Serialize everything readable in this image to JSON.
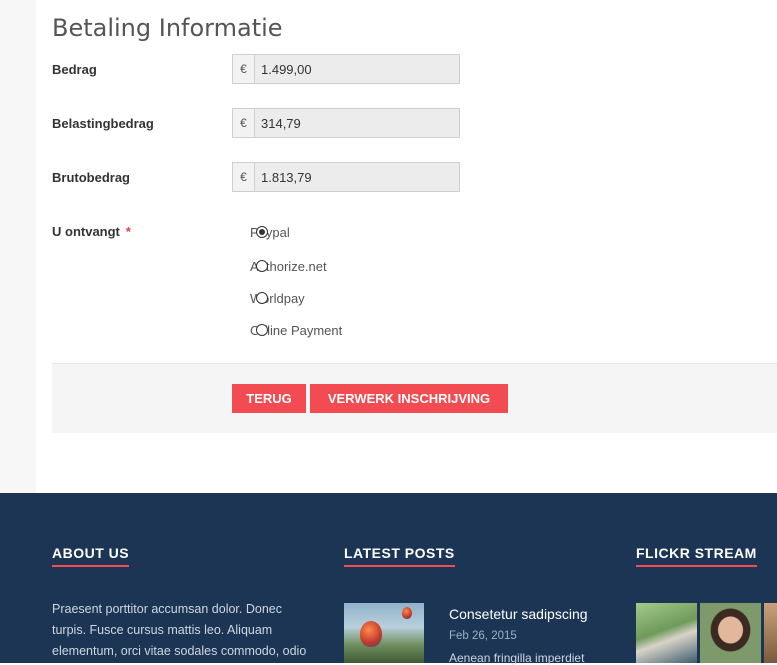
{
  "payment": {
    "title": "Betaling Informatie",
    "currency_symbol": "€",
    "fields": [
      {
        "label": "Bedrag",
        "value": "1.499,00"
      },
      {
        "label": "Belastingbedrag",
        "value": "314,79"
      },
      {
        "label": "Brutobedrag",
        "value": "1.813,79"
      }
    ],
    "method_label": "U ontvangt",
    "required_mark": "*",
    "methods": [
      "Paypal",
      "Authorize.net",
      "Worldpay",
      "Offline Payment"
    ],
    "selected_method": "Paypal",
    "back_label": "TERUG",
    "submit_label": "VERWERK INSCHRIJVING"
  },
  "footer": {
    "about_title": "ABOUT US",
    "about_text": "Praesent porttitor accumsan dolor. Donec turpis. Fusce cursus mattis leo. Aliquam elementum, orci vitae sodales commodo, odio",
    "posts_title": "LATEST POSTS",
    "post": {
      "title": "Consetetur sadipscing",
      "date": "Feb 26, 2015",
      "excerpt": "Aenean fringilla imperdiet"
    },
    "flickr_title": "FLICKR STREAM"
  },
  "colors": {
    "accent": "#f34b52",
    "footer_bg": "#1c3555"
  }
}
